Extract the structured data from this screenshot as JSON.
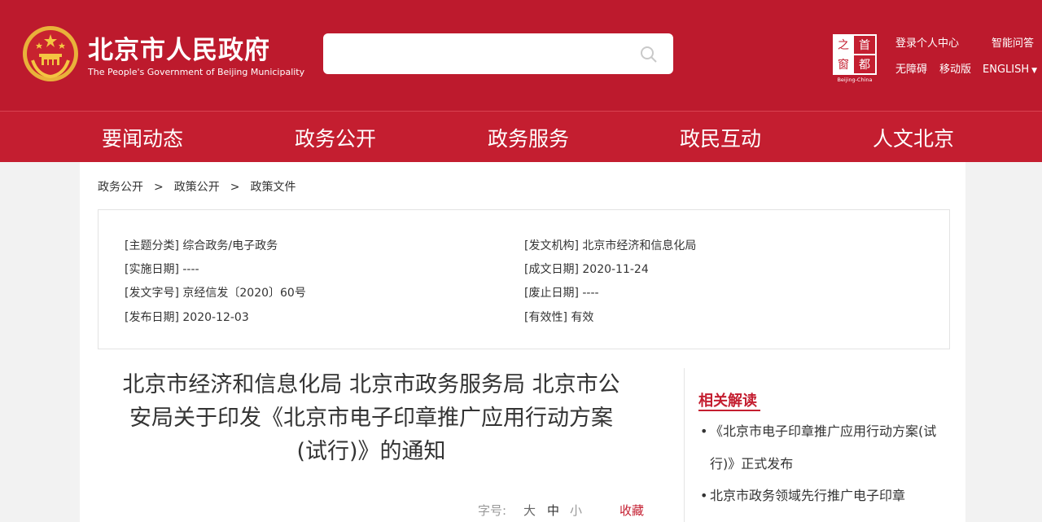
{
  "header": {
    "site_name_cn": "北京市人民政府",
    "site_name_en": "The People's Government of Beijing Municipality",
    "search_placeholder": "",
    "capital_logo_text": "Beijing-China",
    "links": {
      "login": "登录个人中心",
      "smart_qa": "智能问答",
      "accessibility": "无障碍",
      "mobile": "移动版",
      "english": "ENGLISH"
    }
  },
  "nav": {
    "items": [
      "要闻动态",
      "政务公开",
      "政务服务",
      "政民互动",
      "人文北京"
    ]
  },
  "breadcrumb": {
    "items": [
      "政务公开",
      "政策公开",
      "政策文件"
    ],
    "separator": ">"
  },
  "info": {
    "left": [
      "[主题分类] 综合政务/电子政务",
      "[实施日期] ----",
      "[发文字号] 京经信发〔2020〕60号",
      "[发布日期] 2020-12-03"
    ],
    "right": [
      "[发文机构] 北京市经济和信息化局",
      "[成文日期] 2020-11-24",
      "[废止日期] ----",
      "[有效性] 有效"
    ]
  },
  "article": {
    "title_lines": [
      "北京市经济和信息化局 北京市政务服务局 北京市公",
      "安局关于印发《北京市电子印章推广应用行动方案",
      "(试行)》的通知"
    ],
    "font_size_label": "字号:",
    "size_large": "大",
    "size_medium": "中",
    "size_small": "小",
    "favorite": "收藏"
  },
  "related": {
    "heading": "相关解读",
    "items": [
      "《北京市电子印章推广应用行动方案(试行)》正式发布",
      "北京市政务领域先行推广电子印章"
    ]
  },
  "colors": {
    "header_red": "#bd1a2d",
    "nav_red": "#c41e30",
    "accent_red": "#c41e30",
    "page_bg": "#f2f2f2"
  }
}
